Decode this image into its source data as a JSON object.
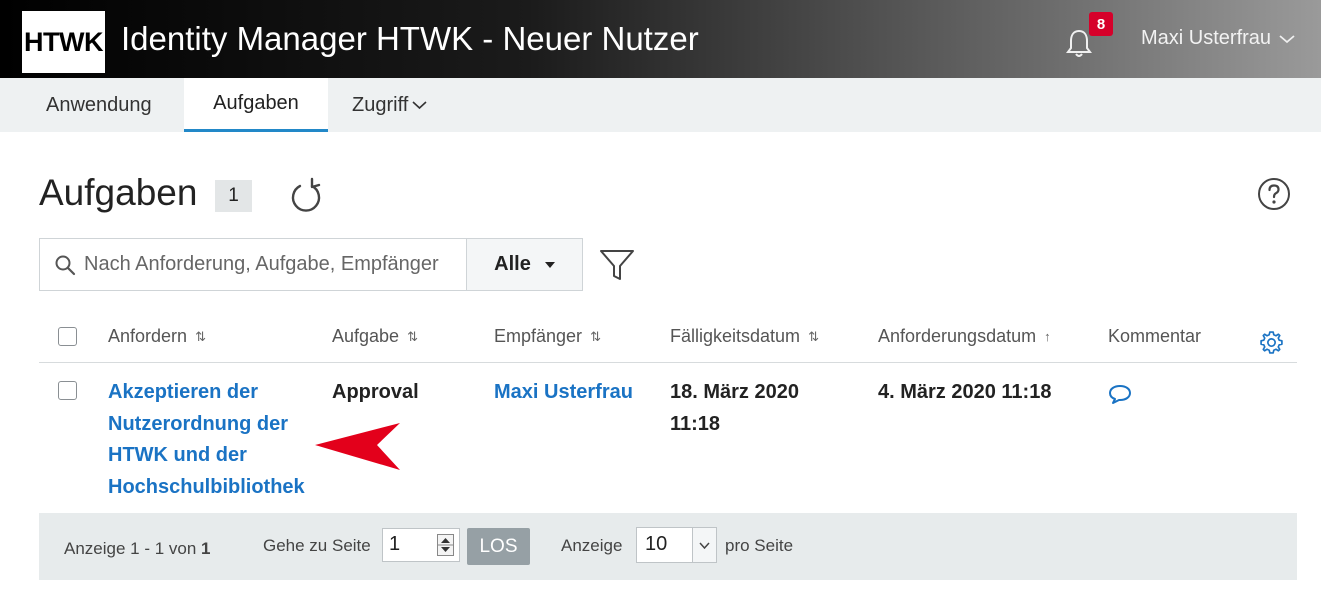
{
  "header": {
    "logo_text": "HTWK",
    "title": "Identity Manager HTWK - Neuer Nutzer",
    "notification_count": "8",
    "user_name": "Maxi Usterfrau"
  },
  "nav": {
    "items": [
      {
        "label": "Anwendung"
      },
      {
        "label": "Aufgaben"
      },
      {
        "label": "Zugriff"
      }
    ]
  },
  "page": {
    "title": "Aufgaben",
    "count": "1"
  },
  "search": {
    "placeholder": "Nach Anforderung, Aufgabe, Empfänger",
    "filter_value": "Alle"
  },
  "table": {
    "columns": [
      "Anfordern",
      "Aufgabe",
      "Empfänger",
      "Fälligkeitsdatum",
      "Anforderungsdatum",
      "Kommentar"
    ],
    "rows": [
      {
        "request_lines": [
          "Akzeptieren der",
          "Nutzerordnung der",
          "HTWK und der",
          "Hochschulbibliothek"
        ],
        "task": "Approval",
        "recipient": "Maxi Usterfrau",
        "due_lines": [
          "18. März 2020",
          "11:18"
        ],
        "request_date": "4. März 2020 11:18"
      }
    ]
  },
  "footer": {
    "range_text": "Anzeige 1 - 1 von",
    "total": "1",
    "goto_label": "Gehe zu Seite",
    "page_value": "1",
    "go_button": "LOS",
    "show_label": "Anzeige",
    "per_page_value": "10",
    "per_page_suffix": "pro Seite"
  },
  "colors": {
    "accent": "#2288c8",
    "link": "#1a73c4",
    "badge": "#d6002a",
    "arrow": "#e3001b"
  }
}
